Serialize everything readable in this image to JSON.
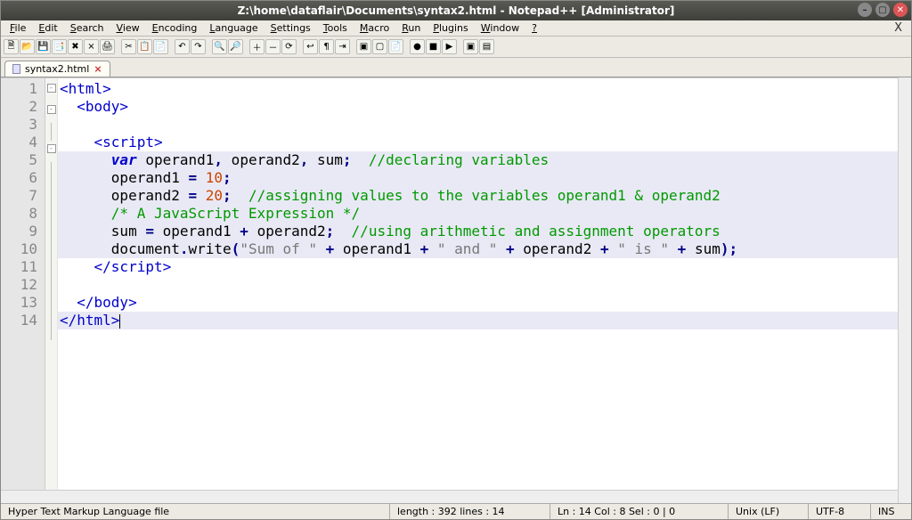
{
  "title": "Z:\\home\\dataflair\\Documents\\syntax2.html - Notepad++ [Administrator]",
  "window_buttons": {
    "min": "–",
    "max": "▢",
    "close": "✕"
  },
  "menus": [
    "File",
    "Edit",
    "Search",
    "View",
    "Encoding",
    "Language",
    "Settings",
    "Tools",
    "Macro",
    "Run",
    "Plugins",
    "Window",
    "?"
  ],
  "menubar_close": "X",
  "tab": {
    "name": "syntax2.html",
    "close": "⨯"
  },
  "gutter_count": 14,
  "toolbar_icons": [
    "new",
    "open",
    "save",
    "save-all",
    "close",
    "close-all",
    "print",
    "|",
    "cut",
    "copy",
    "paste",
    "|",
    "undo",
    "redo",
    "|",
    "find",
    "replace",
    "|",
    "zoom-in",
    "zoom-out",
    "sync",
    "|",
    "wrap",
    "ws",
    "indent",
    "|",
    "fold",
    "unfold",
    "doc",
    "|",
    "rec",
    "stop",
    "play",
    "|",
    "macro1",
    "macro2"
  ],
  "code": [
    {
      "indent": "",
      "segments": [
        {
          "cls": "tag",
          "t": "<html>"
        }
      ]
    },
    {
      "indent": "  ",
      "segments": [
        {
          "cls": "tag",
          "t": "<body>"
        }
      ]
    },
    {
      "indent": "",
      "segments": []
    },
    {
      "indent": "    ",
      "segments": [
        {
          "cls": "tag",
          "t": "<script>"
        }
      ]
    },
    {
      "hl": true,
      "indent": "      ",
      "segments": [
        {
          "cls": "kw",
          "t": "var"
        },
        {
          "cls": "plain",
          "t": " operand1"
        },
        {
          "cls": "pn",
          "t": ","
        },
        {
          "cls": "plain",
          "t": " operand2"
        },
        {
          "cls": "pn",
          "t": ","
        },
        {
          "cls": "plain",
          "t": " sum"
        },
        {
          "cls": "pn",
          "t": ";"
        },
        {
          "cls": "plain",
          "t": "  "
        },
        {
          "cls": "cmt",
          "t": "//declaring variables"
        }
      ]
    },
    {
      "hl": true,
      "indent": "      ",
      "segments": [
        {
          "cls": "plain",
          "t": "operand1 "
        },
        {
          "cls": "pn",
          "t": "="
        },
        {
          "cls": "plain",
          "t": " "
        },
        {
          "cls": "nm",
          "t": "10"
        },
        {
          "cls": "pn",
          "t": ";"
        }
      ]
    },
    {
      "hl": true,
      "indent": "      ",
      "segments": [
        {
          "cls": "plain",
          "t": "operand2 "
        },
        {
          "cls": "pn",
          "t": "="
        },
        {
          "cls": "plain",
          "t": " "
        },
        {
          "cls": "nm",
          "t": "20"
        },
        {
          "cls": "pn",
          "t": ";"
        },
        {
          "cls": "plain",
          "t": "  "
        },
        {
          "cls": "cmt",
          "t": "//assigning values to the variables operand1 & operand2"
        }
      ]
    },
    {
      "hl": true,
      "indent": "      ",
      "segments": [
        {
          "cls": "cmt",
          "t": "/* A JavaScript Expression */"
        }
      ]
    },
    {
      "hl": true,
      "indent": "      ",
      "segments": [
        {
          "cls": "plain",
          "t": "sum "
        },
        {
          "cls": "pn",
          "t": "="
        },
        {
          "cls": "plain",
          "t": " operand1 "
        },
        {
          "cls": "pn",
          "t": "+"
        },
        {
          "cls": "plain",
          "t": " operand2"
        },
        {
          "cls": "pn",
          "t": ";"
        },
        {
          "cls": "plain",
          "t": "  "
        },
        {
          "cls": "cmt",
          "t": "//using arithmetic and assignment operators"
        }
      ]
    },
    {
      "hl": true,
      "indent": "      ",
      "segments": [
        {
          "cls": "plain",
          "t": "document"
        },
        {
          "cls": "pn",
          "t": "."
        },
        {
          "cls": "plain",
          "t": "write"
        },
        {
          "cls": "pn",
          "t": "("
        },
        {
          "cls": "str",
          "t": "\"Sum of \""
        },
        {
          "cls": "plain",
          "t": " "
        },
        {
          "cls": "pn",
          "t": "+"
        },
        {
          "cls": "plain",
          "t": " operand1 "
        },
        {
          "cls": "pn",
          "t": "+"
        },
        {
          "cls": "plain",
          "t": " "
        },
        {
          "cls": "str",
          "t": "\" and \""
        },
        {
          "cls": "plain",
          "t": " "
        },
        {
          "cls": "pn",
          "t": "+"
        },
        {
          "cls": "plain",
          "t": " operand2 "
        },
        {
          "cls": "pn",
          "t": "+"
        },
        {
          "cls": "plain",
          "t": " "
        },
        {
          "cls": "str",
          "t": "\" is \""
        },
        {
          "cls": "plain",
          "t": " "
        },
        {
          "cls": "pn",
          "t": "+"
        },
        {
          "cls": "plain",
          "t": " sum"
        },
        {
          "cls": "pn",
          "t": ");"
        }
      ]
    },
    {
      "indent": "    ",
      "segments": [
        {
          "cls": "tag",
          "t": "</script"
        },
        {
          "cls": "tag",
          "t": ">"
        }
      ]
    },
    {
      "indent": "",
      "segments": []
    },
    {
      "indent": "  ",
      "segments": [
        {
          "cls": "tag",
          "t": "</body>"
        }
      ]
    },
    {
      "hl": true,
      "indent": "",
      "segments": [
        {
          "cls": "tag",
          "t": "</html>"
        }
      ],
      "cursor": true
    }
  ],
  "fold": [
    "box",
    "box",
    "line",
    "box",
    "line",
    "line",
    "line",
    "line",
    "line",
    "line",
    "end",
    "line",
    "end",
    "end"
  ],
  "status": {
    "lang": "Hyper Text Markup Language file",
    "len": "length : 392    lines : 14",
    "pos": "Ln : 14    Col : 8    Sel : 0 | 0",
    "eol": "Unix (LF)",
    "enc": "UTF-8",
    "ins": "INS"
  }
}
